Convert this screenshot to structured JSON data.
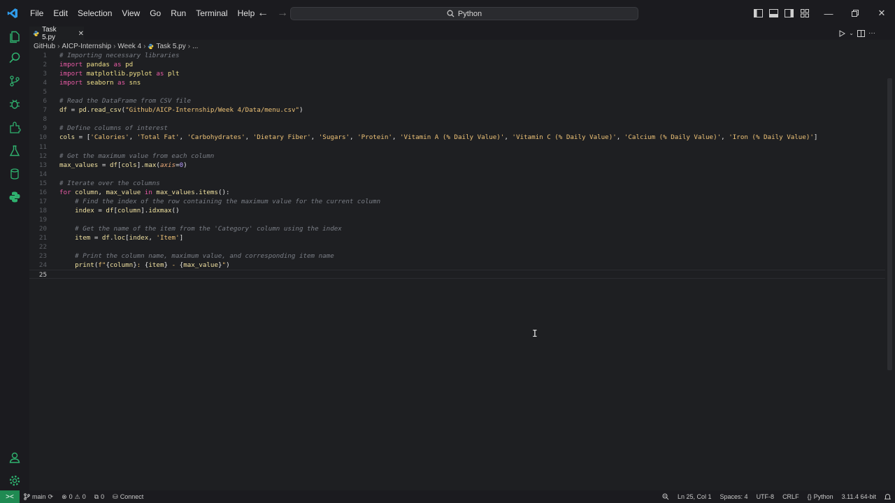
{
  "menu": [
    "File",
    "Edit",
    "Selection",
    "View",
    "Go",
    "Run",
    "Terminal",
    "Help"
  ],
  "search": {
    "text": "Python"
  },
  "tab": {
    "label": "Task 5.py"
  },
  "breadcrumb": [
    "GitHub",
    "AICP-Internship",
    "Week 4",
    "Task 5.py",
    "..."
  ],
  "editor": {
    "current_line": 25,
    "lines": [
      {
        "n": "1",
        "tokens": [
          [
            "comment",
            "# Importing necessary libraries"
          ]
        ]
      },
      {
        "n": "2",
        "tokens": [
          [
            "keyword",
            "import"
          ],
          [
            "plain",
            " "
          ],
          [
            "module",
            "pandas"
          ],
          [
            "plain",
            " "
          ],
          [
            "keyword",
            "as"
          ],
          [
            "plain",
            " "
          ],
          [
            "module",
            "pd"
          ]
        ]
      },
      {
        "n": "3",
        "tokens": [
          [
            "keyword",
            "import"
          ],
          [
            "plain",
            " "
          ],
          [
            "module",
            "matplotlib.pyplot"
          ],
          [
            "plain",
            " "
          ],
          [
            "keyword",
            "as"
          ],
          [
            "plain",
            " "
          ],
          [
            "module",
            "plt"
          ]
        ]
      },
      {
        "n": "4",
        "tokens": [
          [
            "keyword",
            "import"
          ],
          [
            "plain",
            " "
          ],
          [
            "module",
            "seaborn"
          ],
          [
            "plain",
            " "
          ],
          [
            "keyword",
            "as"
          ],
          [
            "plain",
            " "
          ],
          [
            "module",
            "sns"
          ]
        ]
      },
      {
        "n": "5",
        "tokens": []
      },
      {
        "n": "6",
        "tokens": [
          [
            "comment",
            "# Read the DataFrame from CSV file"
          ]
        ]
      },
      {
        "n": "7",
        "tokens": [
          [
            "var",
            "df"
          ],
          [
            "plain",
            " = "
          ],
          [
            "var",
            "pd"
          ],
          [
            "plain",
            "."
          ],
          [
            "func",
            "read_csv"
          ],
          [
            "plain",
            "("
          ],
          [
            "string",
            "\"Github/AICP-Internship/Week 4/Data/menu.csv\""
          ],
          [
            "plain",
            ")"
          ]
        ]
      },
      {
        "n": "8",
        "tokens": []
      },
      {
        "n": "9",
        "tokens": [
          [
            "comment",
            "# Define columns of interest"
          ]
        ]
      },
      {
        "n": "10",
        "tokens": [
          [
            "var",
            "cols"
          ],
          [
            "plain",
            " = ["
          ],
          [
            "string",
            "'Calories'"
          ],
          [
            "plain",
            ", "
          ],
          [
            "string",
            "'Total Fat'"
          ],
          [
            "plain",
            ", "
          ],
          [
            "string",
            "'Carbohydrates'"
          ],
          [
            "plain",
            ", "
          ],
          [
            "string",
            "'Dietary Fiber'"
          ],
          [
            "plain",
            ", "
          ],
          [
            "string",
            "'Sugars'"
          ],
          [
            "plain",
            ", "
          ],
          [
            "string",
            "'Protein'"
          ],
          [
            "plain",
            ", "
          ],
          [
            "string",
            "'Vitamin A (% Daily Value)'"
          ],
          [
            "plain",
            ", "
          ],
          [
            "string",
            "'Vitamin C (% Daily Value)'"
          ],
          [
            "plain",
            ", "
          ],
          [
            "string",
            "'Calcium (% Daily Value)'"
          ],
          [
            "plain",
            ", "
          ],
          [
            "string",
            "'Iron (% Daily Value)'"
          ],
          [
            "plain",
            "]"
          ]
        ]
      },
      {
        "n": "11",
        "tokens": []
      },
      {
        "n": "12",
        "tokens": [
          [
            "comment",
            "# Get the maximum value from each column"
          ]
        ]
      },
      {
        "n": "13",
        "tokens": [
          [
            "var",
            "max_values"
          ],
          [
            "plain",
            " = "
          ],
          [
            "var",
            "df"
          ],
          [
            "plain",
            "["
          ],
          [
            "var",
            "cols"
          ],
          [
            "plain",
            "]."
          ],
          [
            "func",
            "max"
          ],
          [
            "plain",
            "("
          ],
          [
            "param",
            "axis"
          ],
          [
            "plain",
            "="
          ],
          [
            "number",
            "0"
          ],
          [
            "plain",
            ")"
          ]
        ]
      },
      {
        "n": "14",
        "tokens": []
      },
      {
        "n": "15",
        "tokens": [
          [
            "comment",
            "# Iterate over the columns"
          ]
        ]
      },
      {
        "n": "16",
        "tokens": [
          [
            "keyword",
            "for"
          ],
          [
            "plain",
            " "
          ],
          [
            "var",
            "column"
          ],
          [
            "plain",
            ", "
          ],
          [
            "var",
            "max_value"
          ],
          [
            "plain",
            " "
          ],
          [
            "keyword",
            "in"
          ],
          [
            "plain",
            " "
          ],
          [
            "var",
            "max_values"
          ],
          [
            "plain",
            "."
          ],
          [
            "func",
            "items"
          ],
          [
            "plain",
            "():"
          ]
        ]
      },
      {
        "n": "17",
        "tokens": [
          [
            "plain",
            "    "
          ],
          [
            "comment",
            "# Find the index of the row containing the maximum value for the current column"
          ]
        ]
      },
      {
        "n": "18",
        "tokens": [
          [
            "plain",
            "    "
          ],
          [
            "var",
            "index"
          ],
          [
            "plain",
            " = "
          ],
          [
            "var",
            "df"
          ],
          [
            "plain",
            "["
          ],
          [
            "var",
            "column"
          ],
          [
            "plain",
            "]."
          ],
          [
            "func",
            "idxmax"
          ],
          [
            "plain",
            "()"
          ]
        ]
      },
      {
        "n": "19",
        "tokens": []
      },
      {
        "n": "20",
        "tokens": [
          [
            "plain",
            "    "
          ],
          [
            "comment",
            "# Get the name of the item from the 'Category' column using the index"
          ]
        ]
      },
      {
        "n": "21",
        "tokens": [
          [
            "plain",
            "    "
          ],
          [
            "var",
            "item"
          ],
          [
            "plain",
            " = "
          ],
          [
            "var",
            "df"
          ],
          [
            "plain",
            "."
          ],
          [
            "var",
            "loc"
          ],
          [
            "plain",
            "["
          ],
          [
            "var",
            "index"
          ],
          [
            "plain",
            ", "
          ],
          [
            "string",
            "'Item'"
          ],
          [
            "plain",
            "]"
          ]
        ]
      },
      {
        "n": "22",
        "tokens": []
      },
      {
        "n": "23",
        "tokens": [
          [
            "plain",
            "    "
          ],
          [
            "comment",
            "# Print the column name, maximum value, and corresponding item name"
          ]
        ]
      },
      {
        "n": "24",
        "tokens": [
          [
            "plain",
            "    "
          ],
          [
            "func",
            "print"
          ],
          [
            "plain",
            "("
          ],
          [
            "string",
            "f\""
          ],
          [
            "plain",
            "{"
          ],
          [
            "var",
            "column"
          ],
          [
            "plain",
            "}"
          ],
          [
            "string",
            ": "
          ],
          [
            "plain",
            "{"
          ],
          [
            "var",
            "item"
          ],
          [
            "plain",
            "}"
          ],
          [
            "string",
            " - "
          ],
          [
            "plain",
            "{"
          ],
          [
            "var",
            "max_value"
          ],
          [
            "plain",
            "}"
          ],
          [
            "string",
            "\""
          ],
          [
            "plain",
            ")"
          ]
        ]
      },
      {
        "n": "25",
        "tokens": []
      }
    ]
  },
  "status": {
    "remote_icon": "><",
    "branch": "main",
    "errors": "0",
    "warnings": "0",
    "ports": "0",
    "connect": "Connect",
    "position": "Ln 25, Col 1",
    "spaces": "Spaces: 4",
    "encoding": "UTF-8",
    "eol": "CRLF",
    "language": "Python",
    "interpreter": "3.11.4 64-bit"
  },
  "colors": {
    "accent": "#1f8a52",
    "background": "#1e1f22",
    "chrome": "#1b1b1f"
  }
}
